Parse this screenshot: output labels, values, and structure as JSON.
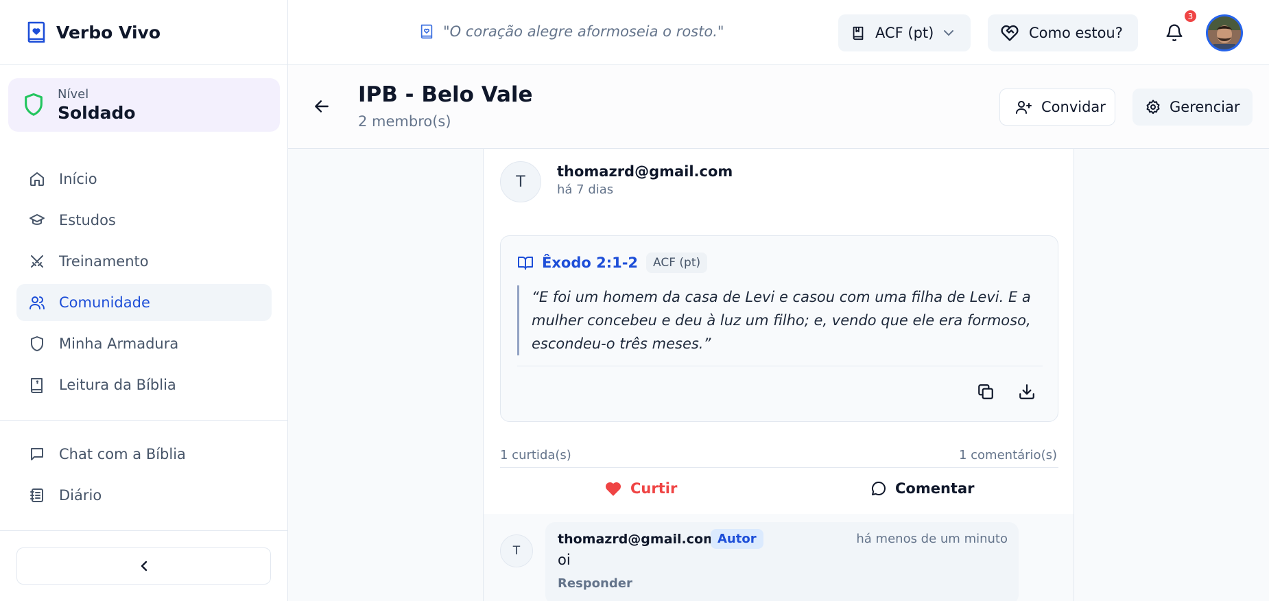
{
  "brand": {
    "name": "Verbo Vivo"
  },
  "level": {
    "label": "Nível",
    "value": "Soldado"
  },
  "nav": [
    {
      "label": "Início",
      "icon": "home-icon"
    },
    {
      "label": "Estudos",
      "icon": "graduation-cap-icon"
    },
    {
      "label": "Treinamento",
      "icon": "crossed-swords-icon"
    },
    {
      "label": "Comunidade",
      "icon": "users-icon",
      "active": true
    },
    {
      "label": "Minha Armadura",
      "icon": "shield-icon"
    },
    {
      "label": "Leitura da Bíblia",
      "icon": "bible-icon"
    }
  ],
  "nav2": [
    {
      "label": "Chat com a Bíblia",
      "icon": "chat-icon"
    },
    {
      "label": "Diário",
      "icon": "notebook-icon"
    }
  ],
  "topbar": {
    "verse": "\"O coração alegre aformoseia o rosto.\"",
    "version": "ACF (pt)",
    "mood": "Como estou?",
    "notifications": "3"
  },
  "group": {
    "title": "IPB - Belo Vale",
    "members": "2 membro(s)",
    "invite": "Convidar",
    "manage": "Gerenciar"
  },
  "post": {
    "avatar_initial": "T",
    "author": "thomazrd@gmail.com",
    "time": "há 7 dias",
    "verse_ref": "Êxodo 2:1-2",
    "verse_version": "ACF (pt)",
    "verse_text": "“E foi um homem da casa de Levi e casou com uma filha de Levi. E a mulher concebeu e deu à luz um filho; e, vendo que ele era formoso, escondeu-o três meses.”",
    "likes": "1 curtida(s)",
    "comments": "1 comentário(s)",
    "like_label": "Curtir",
    "comment_label": "Comentar"
  },
  "comment": {
    "avatar_initial": "T",
    "author": "thomazrd@gmail.com",
    "badge": "Autor",
    "time": "há menos de um minuto",
    "text": "oi",
    "reply": "Responder"
  },
  "colors": {
    "accent": "#1d4ed8",
    "like": "#ef4444",
    "level_bg": "#f3f0fd",
    "shield": "#22c55e"
  }
}
